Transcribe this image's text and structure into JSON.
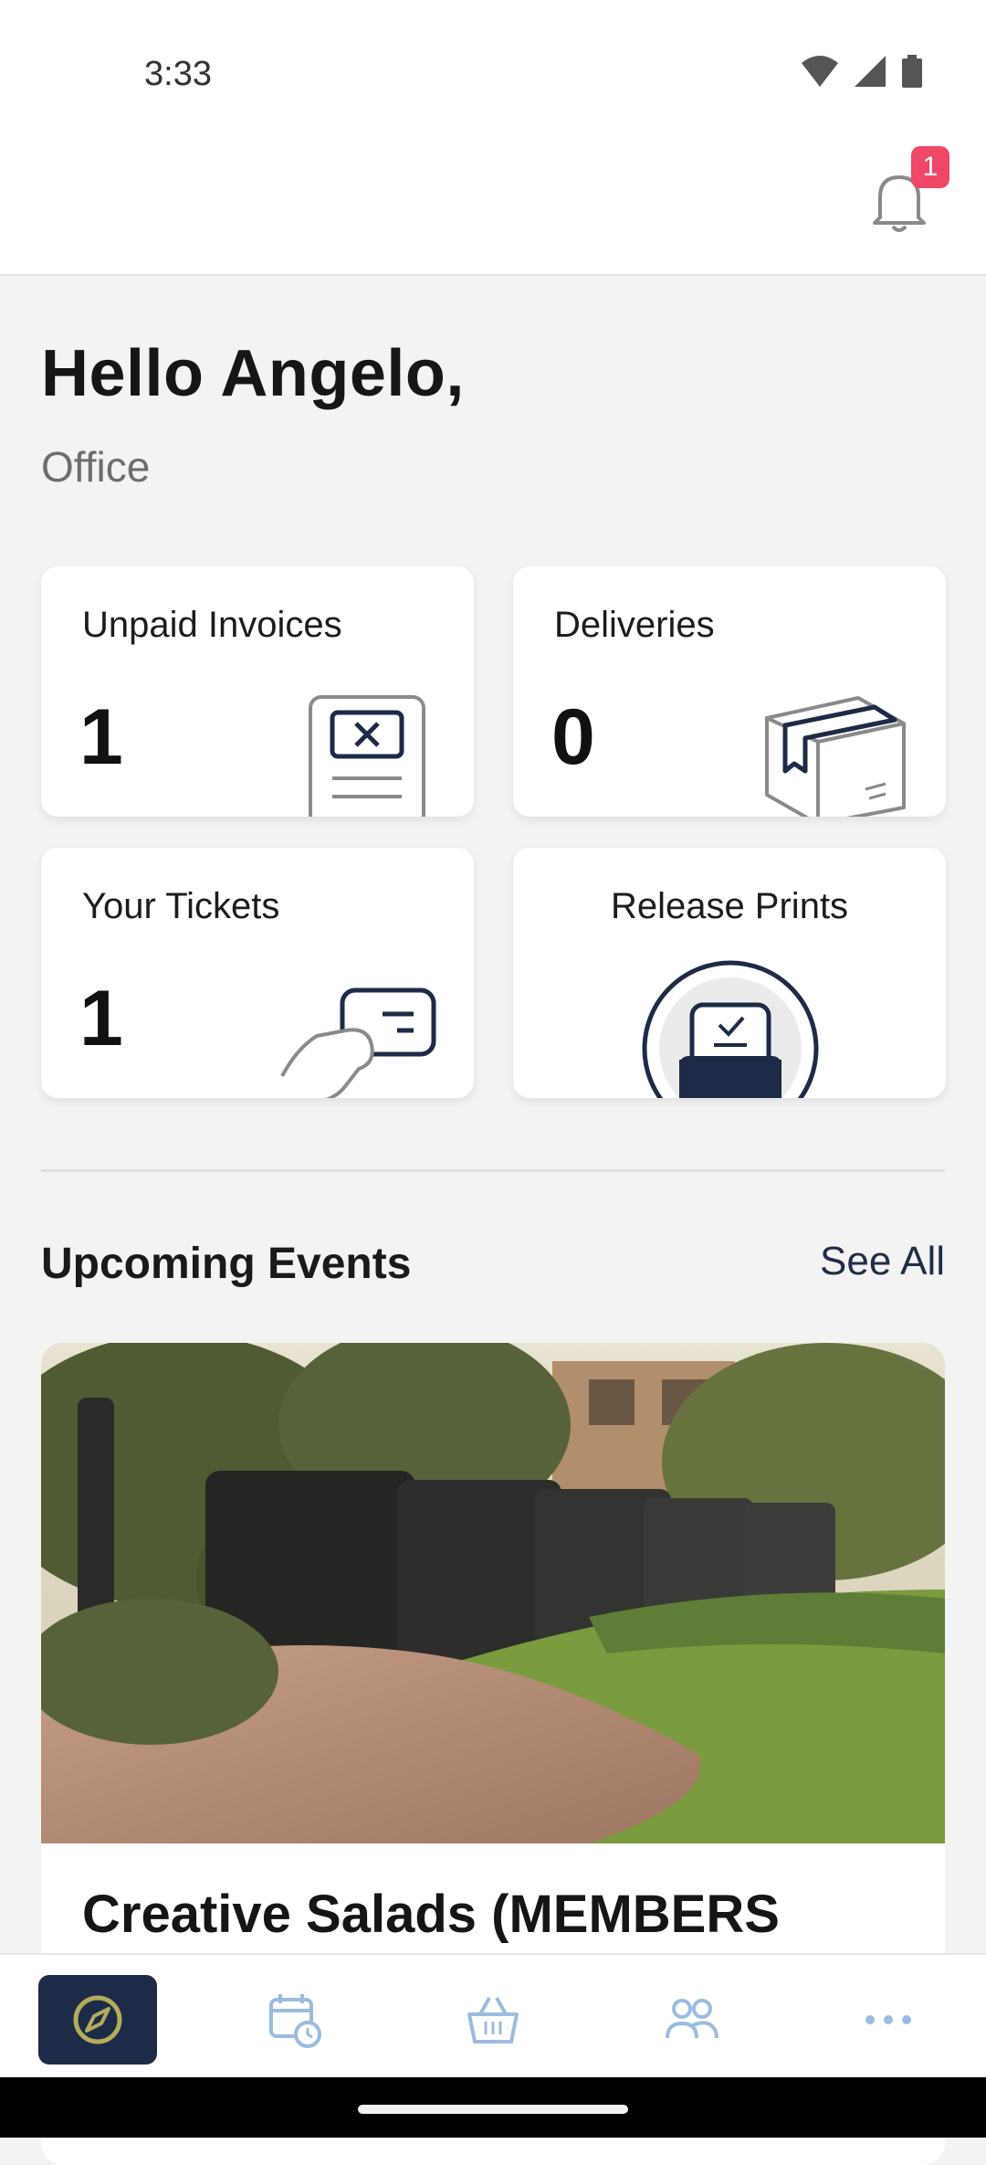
{
  "status_bar": {
    "time": "3:33"
  },
  "notifications": {
    "count": "1"
  },
  "greeting": {
    "title": "Hello Angelo,",
    "subtitle": "Office"
  },
  "cards": [
    {
      "label": "Unpaid Invoices",
      "count": "1",
      "icon": "invoice-icon"
    },
    {
      "label": "Deliveries",
      "count": "0",
      "icon": "package-icon"
    },
    {
      "label": "Your Tickets",
      "count": "1",
      "icon": "ticket-hand-icon"
    },
    {
      "label": "Release Prints",
      "icon": "print-tray-icon"
    }
  ],
  "events": {
    "section_title": "Upcoming Events",
    "see_all": "See All",
    "items": [
      {
        "title": "Creative Salads (MEMBERS"
      }
    ]
  },
  "nav": {
    "items": [
      {
        "icon": "compass-icon",
        "active": true
      },
      {
        "icon": "calendar-clock-icon"
      },
      {
        "icon": "basket-icon"
      },
      {
        "icon": "people-icon"
      },
      {
        "icon": "more-icon"
      }
    ]
  },
  "colors": {
    "accent": "#1d2b48",
    "badge": "#ef4766",
    "nav_icon": "#9bbbe0",
    "active_icon": "#b3ad5c"
  }
}
